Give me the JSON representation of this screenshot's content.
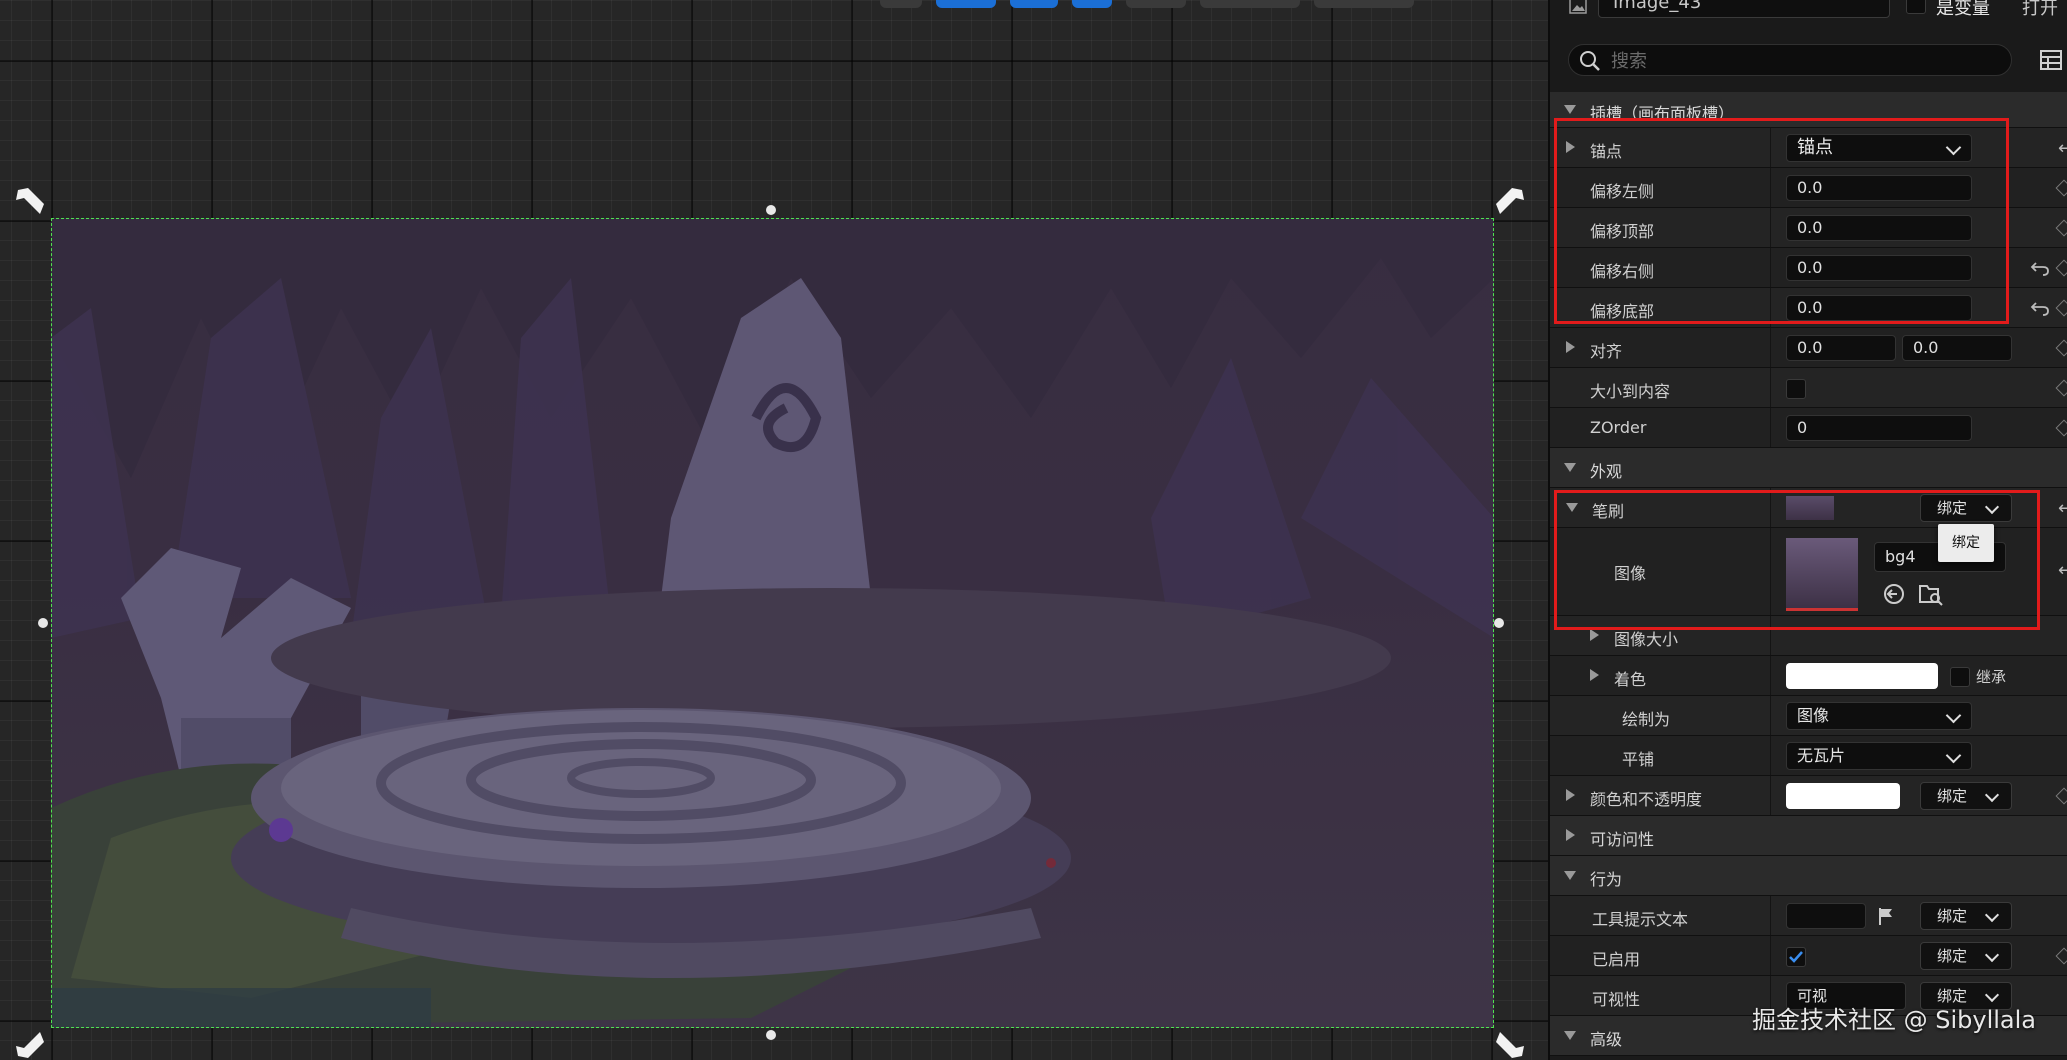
{
  "details": {
    "widget_name": "Image_43",
    "is_variable_label": "是变量",
    "open_link": "打开",
    "search_placeholder": "搜索",
    "slot_section": "插槽（画布面板槽）",
    "anchors": {
      "label": "锚点",
      "value": "锚点"
    },
    "offset_left": {
      "label": "偏移左侧",
      "value": "0.0"
    },
    "offset_top": {
      "label": "偏移顶部",
      "value": "0.0"
    },
    "offset_right": {
      "label": "偏移右侧",
      "value": "0.0"
    },
    "offset_bottom": {
      "label": "偏移底部",
      "value": "0.0"
    },
    "alignment": {
      "label": "对齐",
      "x": "0.0",
      "y": "0.0"
    },
    "size_to_content": {
      "label": "大小到内容"
    },
    "zorder": {
      "label": "ZOrder",
      "value": "0"
    },
    "appearance_section": "外观",
    "brush": {
      "label": "笔刷",
      "bind_label": "绑定"
    },
    "image": {
      "label": "图像",
      "asset": "bg4"
    },
    "image_size": {
      "label": "图像大小"
    },
    "tint": {
      "label": "着色",
      "inherit_label": "继承"
    },
    "draw_as": {
      "label": "绘制为",
      "value": "图像"
    },
    "tiling": {
      "label": "平铺",
      "value": "无瓦片"
    },
    "color_opacity": {
      "label": "颜色和不透明度",
      "bind_label": "绑定"
    },
    "accessibility_section": "可访问性",
    "behavior_section": "行为",
    "tooltip_text": {
      "label": "工具提示文本",
      "bind_label": "绑定"
    },
    "is_enabled": {
      "label": "已启用",
      "bind_label": "绑定"
    },
    "visibility": {
      "label": "可视性",
      "value": "可视",
      "bind_label": "绑定"
    },
    "advanced_section": "高级"
  },
  "tooltip": "绑定",
  "watermark": "掘金技术社区 @ Sibyllala",
  "colors": {
    "highlight": "#e21b1b",
    "selection": "#4fe34f",
    "panel_bg": "#1a1a1a",
    "accent_blue": "#1b6fd6"
  }
}
